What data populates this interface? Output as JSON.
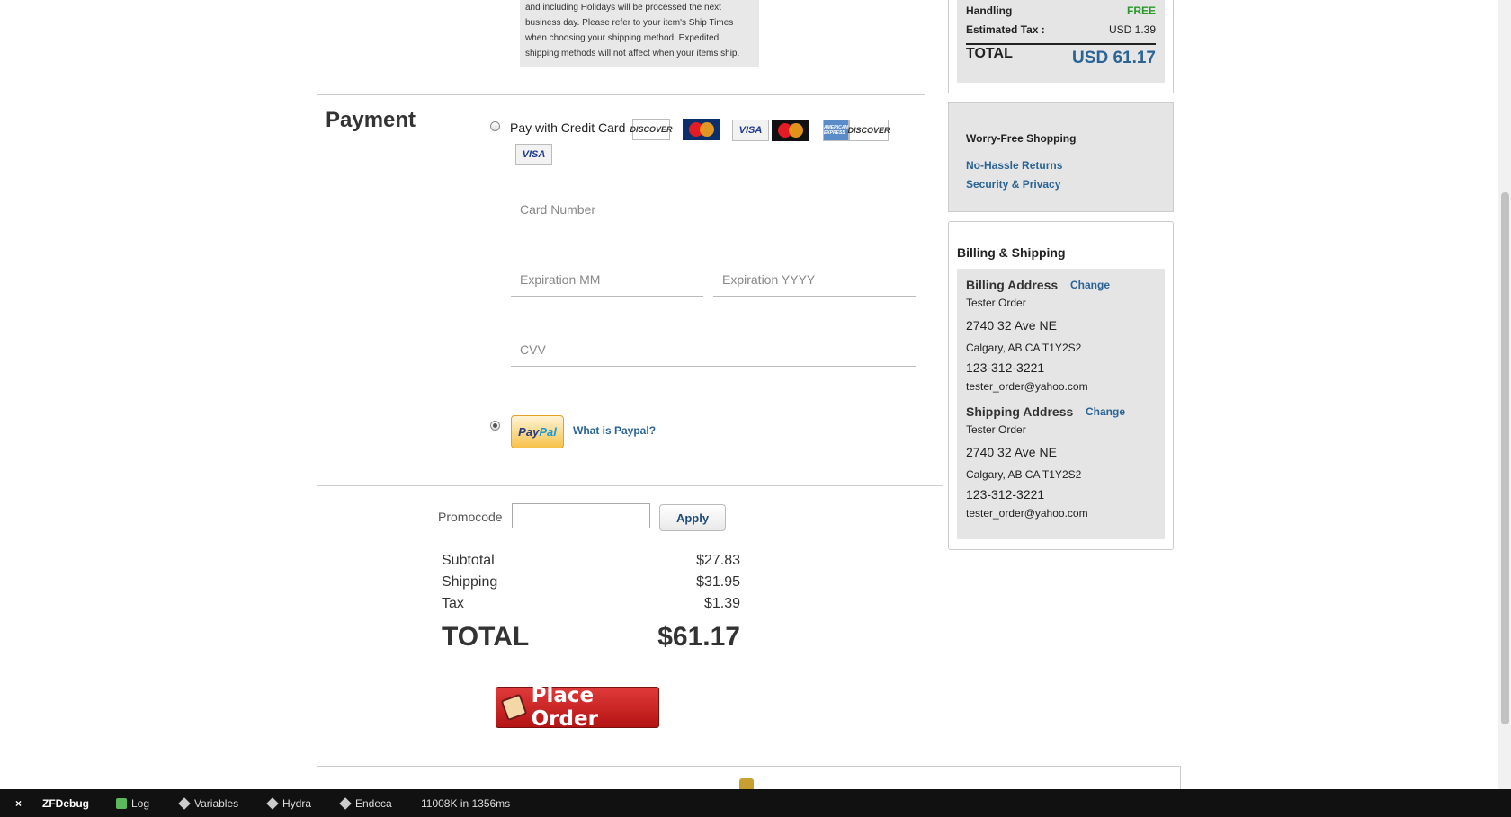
{
  "shipping_note": {
    "lines": [
      "and including Holidays will be processed the next",
      "business day. Please refer to your item's Ship Times",
      "when choosing your shipping method. Expedited",
      "shipping methods will not affect when your items ship."
    ]
  },
  "payment": {
    "title": "Payment",
    "credit_card_label": "Pay with Credit Card",
    "cards": [
      "DISCOVER",
      "MasterCard",
      "VISA",
      "MasterCard",
      "AMERICAN EXPRESS",
      "DISCOVER",
      "VISA"
    ],
    "card_number_placeholder": "Card Number",
    "exp_month_placeholder": "Expiration MM",
    "exp_year_placeholder": "Expiration YYYY",
    "cvv_placeholder": "CVV",
    "paypal_logo_p1": "Pay",
    "paypal_logo_p2": "Pal",
    "what_is_paypal": "What is Paypal?",
    "selected_method": "paypal"
  },
  "promo": {
    "label": "Promocode",
    "value": "",
    "apply_label": "Apply"
  },
  "summary": {
    "subtotal_label": "Subtotal",
    "subtotal": "$27.83",
    "shipping_label": "Shipping",
    "shipping": "$31.95",
    "tax_label": "Tax",
    "tax": "$1.39",
    "total_label": "TOTAL",
    "total": "$61.17"
  },
  "place_order_label": "Place Order",
  "order_box": {
    "handling_label": "Handling",
    "handling_value": "FREE",
    "tax_label": "Estimated Tax :",
    "tax_value": "USD 1.39",
    "total_label": "TOTAL",
    "total_value": "USD 61.17"
  },
  "worry_free": {
    "title": "Worry-Free Shopping",
    "returns_link": "No-Hassle Returns",
    "security_link": "Security & Privacy"
  },
  "billing_shipping": {
    "title": "Billing & Shipping",
    "billing": {
      "heading": "Billing Address",
      "change_label": "Change",
      "name": "Tester Order",
      "street": "2740 32 Ave NE",
      "city": "Calgary, AB CA T1Y2S2",
      "phone": "123-312-3221",
      "email": "tester_order@yahoo.com"
    },
    "shipping": {
      "heading": "Shipping Address",
      "change_label": "Change",
      "name": "Tester Order",
      "street": "2740 32 Ave NE",
      "city": "Calgary, AB CA T1Y2S2",
      "phone": "123-312-3221",
      "email": "tester_order@yahoo.com"
    }
  },
  "debugbar": {
    "close": "×",
    "title": "ZFDebug",
    "log": "Log",
    "variables": "Variables",
    "hydra": "Hydra",
    "endeca": "Endeca",
    "stats": "11008K in 1356ms"
  },
  "colors": {
    "link": "#2a6496",
    "free_green": "#2a9a2a",
    "place_order_red": "#c21d1d"
  }
}
